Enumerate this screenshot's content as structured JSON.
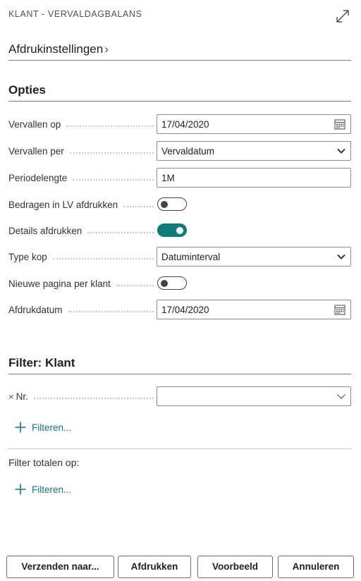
{
  "dialog": {
    "title": "KLANT - VERVALDAGBALANS"
  },
  "print_settings": {
    "label": "Afdrukinstellingen"
  },
  "options": {
    "header": "Opties",
    "fields": {
      "aged_as_of": {
        "label": "Vervallen op",
        "value": "17/04/2020"
      },
      "aged_by": {
        "label": "Vervallen per",
        "value": "Vervaldatum"
      },
      "period_length": {
        "label": "Periodelengte",
        "value": "1M"
      },
      "amounts_lcy": {
        "label": "Bedragen in LV afdrukken",
        "checked": false
      },
      "print_details": {
        "label": "Details afdrukken",
        "checked": true
      },
      "heading_type": {
        "label": "Type kop",
        "value": "Datuminterval"
      },
      "new_page": {
        "label": "Nieuwe pagina per klant",
        "checked": false
      },
      "print_date": {
        "label": "Afdrukdatum",
        "value": "17/04/2020"
      }
    }
  },
  "filter_customer": {
    "header": "Filter: Klant",
    "no_field": {
      "remove": "×",
      "label": "Nr.",
      "value": ""
    },
    "add_filter": "Filteren..."
  },
  "filter_totals": {
    "label": "Filter totalen op:",
    "add_filter": "Filteren..."
  },
  "footer": {
    "send_to": "Verzenden naar...",
    "print": "Afdrukken",
    "preview": "Voorbeeld",
    "cancel": "Annuleren"
  },
  "colors": {
    "accent": "#0e7c7b",
    "border": "#8a8a8a"
  },
  "icons": [
    "expand-icon",
    "chevron-right-icon",
    "calendar-icon",
    "chevron-down-icon",
    "plus-icon",
    "close-icon"
  ]
}
